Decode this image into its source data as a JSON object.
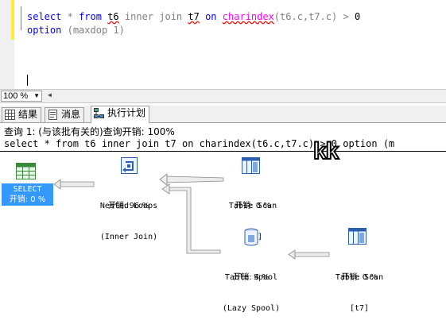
{
  "editor": {
    "line1": {
      "kw1": "select",
      "star": "*",
      "kw2": "from",
      "t1": "t6",
      "inner": "inner",
      "join": "join",
      "t2": "t7",
      "on": "on",
      "fn": "charindex",
      "args": "(t6.c,t7.c)",
      "gt": ">",
      "zero": "0"
    },
    "line2": {
      "option": "option",
      "hint": "(maxdop 1)"
    }
  },
  "zoom": {
    "value": "100 %"
  },
  "tabs": [
    {
      "label": "结果",
      "icon": "grid-icon"
    },
    {
      "label": "消息",
      "icon": "message-icon"
    },
    {
      "label": "执行计划",
      "icon": "execution-plan-icon"
    }
  ],
  "plan": {
    "header_line1": "查询 1: (与该批有关的)查询开销: 100%",
    "header_line2": "select * from t6 inner join t7 on charindex(t6.c,t7.c) > 0 option (m",
    "watermark": "kk",
    "nodes": {
      "select": {
        "name": "SELECT",
        "cost": "开销: 0 %"
      },
      "nested_loops": {
        "name": "Nested Loops",
        "sub": "(Inner Join)",
        "cost": "开销: 96 %"
      },
      "scan_t6": {
        "name": "Table Scan",
        "sub": "[t6]",
        "cost": "开销: 0 %"
      },
      "spool": {
        "name": "Table Spool",
        "sub": "(Lazy Spool)",
        "cost": "开销: 4 %"
      },
      "scan_t7": {
        "name": "Table Scan",
        "sub": "[t7]",
        "cost": "开销: 0 %"
      }
    }
  },
  "colors": {
    "keyword": "#0000ff",
    "function": "#ff00ff",
    "selected_node": "#3399ff"
  }
}
